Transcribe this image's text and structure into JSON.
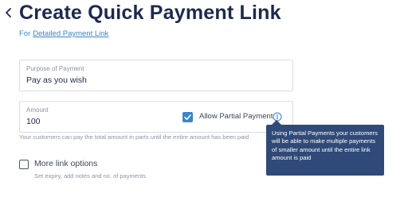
{
  "header": {
    "back_icon": "chevron-left-icon",
    "title": "Create Quick Payment Link",
    "alt_prefix": "For",
    "alt_link": "Detailed Payment Link"
  },
  "form": {
    "purpose": {
      "label": "Purpose of Payment",
      "value": "Pay as you wish"
    },
    "amount": {
      "label": "Amount",
      "value": "100",
      "hint": "Your customers can pay the total amount in parts until the entire amount has been paid"
    },
    "partial_payment": {
      "checked": true,
      "label": "Allow Partial Payment",
      "info_icon": "info-circle-icon",
      "tooltip": "Using Partial Payments your customers will be able to make multiple payments of smaller amount until the entire link amount is paid"
    },
    "more_options": {
      "checked": false,
      "label": "More link options",
      "hint": "Set expiry, add notes and no. of payments"
    }
  },
  "colors": {
    "accent": "#3a86c8",
    "title": "#1c2a4d",
    "tooltip_bg": "#2f4a78",
    "muted": "#8a93a6"
  }
}
